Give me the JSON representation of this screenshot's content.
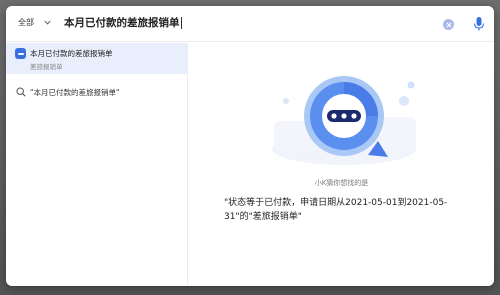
{
  "search": {
    "scope_label": "全部",
    "query": "本月已付款的差旅报销单"
  },
  "suggestions": {
    "app_item": {
      "title": "本月已付款的差旅报销单",
      "subtitle": "差旅报销单"
    },
    "search_item": {
      "text": "\"本月已付款的差旅报销单\""
    }
  },
  "result": {
    "guess_label": "小K猜你想找的是",
    "interpretation": "\"状态等于已付款，申请日期从2021-05-01到2021-05-31\"的\"差旅报销单\""
  },
  "colors": {
    "accent": "#3a6fe0",
    "highlight_bg": "#e8eefc"
  }
}
